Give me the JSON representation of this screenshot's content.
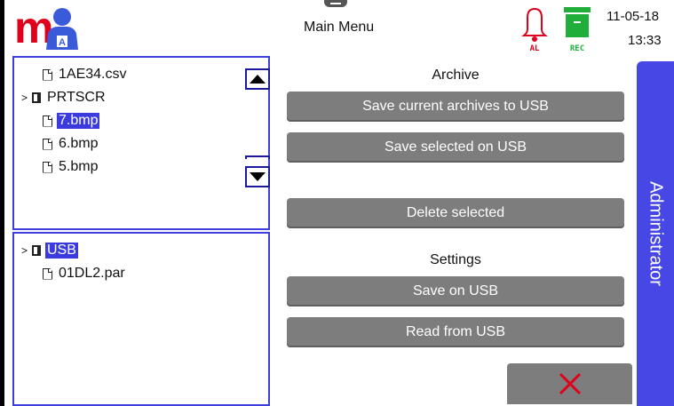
{
  "header": {
    "title": "Main Menu",
    "date": "11-05-18",
    "time": "13:33",
    "alarm_label": "AL",
    "rec_label": "REC",
    "logo_letter": "m",
    "user_badge": "A",
    "colors": {
      "logo": "#e0001b",
      "user": "#3a5bd9",
      "alarm": "#e0001b",
      "rec": "#1fae3a"
    }
  },
  "file_tree_top": {
    "items": [
      {
        "label": "1AE34.csv",
        "type": "file",
        "indent": 1,
        "selected": false
      },
      {
        "label": "PRTSCR",
        "type": "folder",
        "indent": 0,
        "selected": false
      },
      {
        "label": "7.bmp",
        "type": "file",
        "indent": 1,
        "selected": true
      },
      {
        "label": "6.bmp",
        "type": "file",
        "indent": 1,
        "selected": false
      },
      {
        "label": "5.bmp",
        "type": "file",
        "indent": 1,
        "selected": false
      }
    ]
  },
  "file_tree_bottom": {
    "items": [
      {
        "label": "USB",
        "type": "folder",
        "indent": 0,
        "selected": true
      },
      {
        "label": "01DL2.par",
        "type": "file",
        "indent": 1,
        "selected": false
      }
    ]
  },
  "archive": {
    "title": "Archive",
    "save_current_label": "Save current archives to USB",
    "save_selected_label": "Save selected on USB",
    "delete_selected_label": "Delete selected"
  },
  "settings": {
    "title": "Settings",
    "save_label": "Save on USB",
    "read_label": "Read from USB"
  },
  "side_tab": {
    "label": "Administrator"
  },
  "accent_color": "#4747e6"
}
